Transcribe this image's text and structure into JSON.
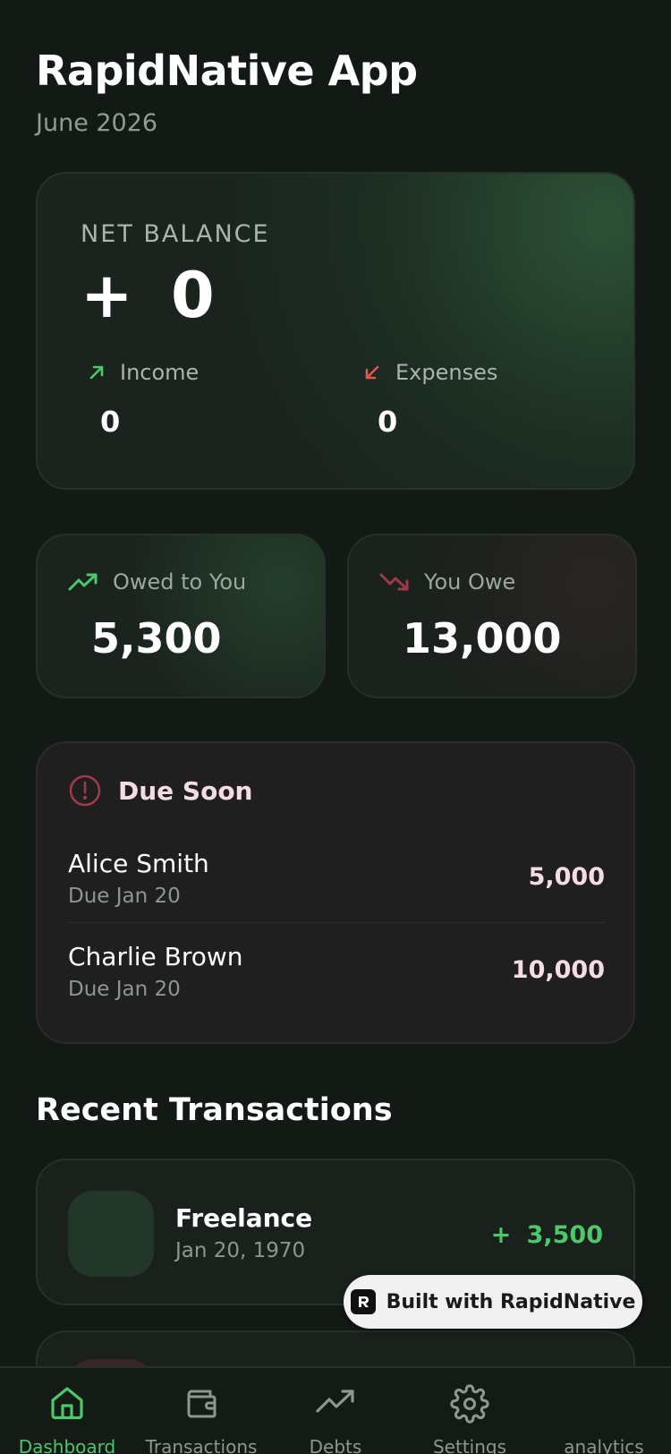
{
  "header": {
    "title": "RapidNative App",
    "subtitle": "June 2026"
  },
  "balance": {
    "label": "NET BALANCE",
    "value": "+ 0",
    "income_label": "Income",
    "income_value": "0",
    "expenses_label": "Expenses",
    "expenses_value": "0"
  },
  "owed_to_you": {
    "label": "Owed to You",
    "value": "5,300"
  },
  "you_owe": {
    "label": "You Owe",
    "value": "13,000"
  },
  "due_soon": {
    "title": "Due Soon",
    "items": [
      {
        "name": "Alice Smith",
        "date": "Due Jan 20",
        "amount": "5,000"
      },
      {
        "name": "Charlie Brown",
        "date": "Due Jan 20",
        "amount": "10,000"
      }
    ]
  },
  "recent": {
    "title": "Recent Transactions",
    "items": [
      {
        "name": "Freelance",
        "date": "Jan 20, 1970",
        "amount": "+ 3,500"
      }
    ]
  },
  "badge": {
    "text": "Built with RapidNative"
  },
  "tabs": [
    {
      "label": "Dashboard",
      "icon": "home-icon",
      "active": true
    },
    {
      "label": "Transactions",
      "icon": "wallet-icon",
      "active": false
    },
    {
      "label": "Debts",
      "icon": "trending-up-icon",
      "active": false
    },
    {
      "label": "Settings",
      "icon": "gear-icon",
      "active": false
    },
    {
      "label": "analytics",
      "icon": "analytics-icon",
      "active": false
    }
  ],
  "colors": {
    "background": "#131915",
    "accent_green": "#4cc86a",
    "accent_red": "#e0574f",
    "due_red": "#a03a4a"
  }
}
